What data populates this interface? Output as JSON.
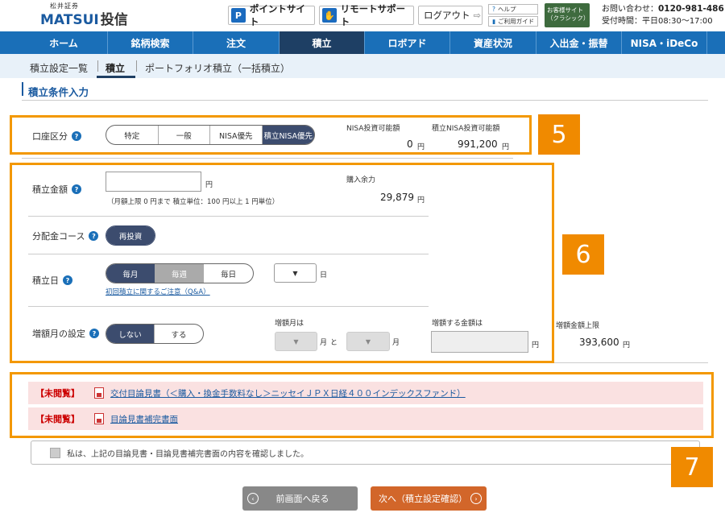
{
  "header": {
    "logo_small": "松井証券",
    "logo_main": "MATSUI",
    "logo_kanji": "投信",
    "point_site": "ポイントサイト",
    "remote_support": "リモートサポート",
    "logout": "ログアウト",
    "help": "ヘルプ",
    "guide": "ご利用ガイド",
    "classic_line1": "お客様サイト",
    "classic_line2": "（クラシック）",
    "contact_label": "お問い合わせ：",
    "contact_phone": "0120-981-486",
    "contact_hours": "受付時間：平日08:30～17:00"
  },
  "nav": [
    "ホーム",
    "銘柄検索",
    "注文",
    "積立",
    "ロボアド",
    "資産状況",
    "入出金・振替",
    "NISA・iDeCo"
  ],
  "subnav": [
    "積立設定一覧",
    "積立",
    "ポートフォリオ積立（一括積立）"
  ],
  "section_title": "積立条件入力",
  "markers": [
    "5",
    "6",
    "7"
  ],
  "account": {
    "label": "口座区分",
    "options": [
      "特定",
      "一般",
      "NISA優先",
      "積立NISA優先"
    ],
    "selected": "積立NISA優先",
    "nisa_label": "NISA投資可能額",
    "nisa_value": "0",
    "tsumitate_label": "積立NISA投資可能額",
    "tsumitate_value": "991,200",
    "yen": "円"
  },
  "amount": {
    "label": "積立金額",
    "value": "",
    "unit": "円",
    "note": "（月額上限 0 円まで  積立単位：100 円以上 1 円単位）",
    "buying_power_label": "購入余力",
    "buying_power_value": "29,879"
  },
  "distribution": {
    "label": "分配金コース",
    "option": "再投資"
  },
  "schedule": {
    "label": "積立日",
    "options": [
      "毎月",
      "毎週",
      "毎日"
    ],
    "day_unit": "日",
    "link": "初回積立に関するご注意（Q&A）"
  },
  "increase": {
    "label": "増額月の設定",
    "options": [
      "しない",
      "する"
    ],
    "month_label": "増額月は",
    "month_unit": "月",
    "and": "と",
    "amount_label": "増額する金額は",
    "limit_label": "増額金額上限",
    "limit_value": "393,600"
  },
  "documents": {
    "unread": "【未閲覧】",
    "items": [
      "交付目論見書（＜購入・換金手数料なし＞ニッセイＪＰＸ日経４００インデックスファンド）",
      "目論見書補完書面"
    ],
    "confirm": "私は、上記の目論見書・目論見書補完書面の内容を確認しました。"
  },
  "buttons": {
    "back": "前画面へ戻る",
    "next": "次へ（積立設定確認）"
  },
  "colors": {
    "nav": "#1a6fb8",
    "nav_active": "#1e3f64",
    "accent_orange": "#f39800",
    "next_button": "#d2662a"
  }
}
